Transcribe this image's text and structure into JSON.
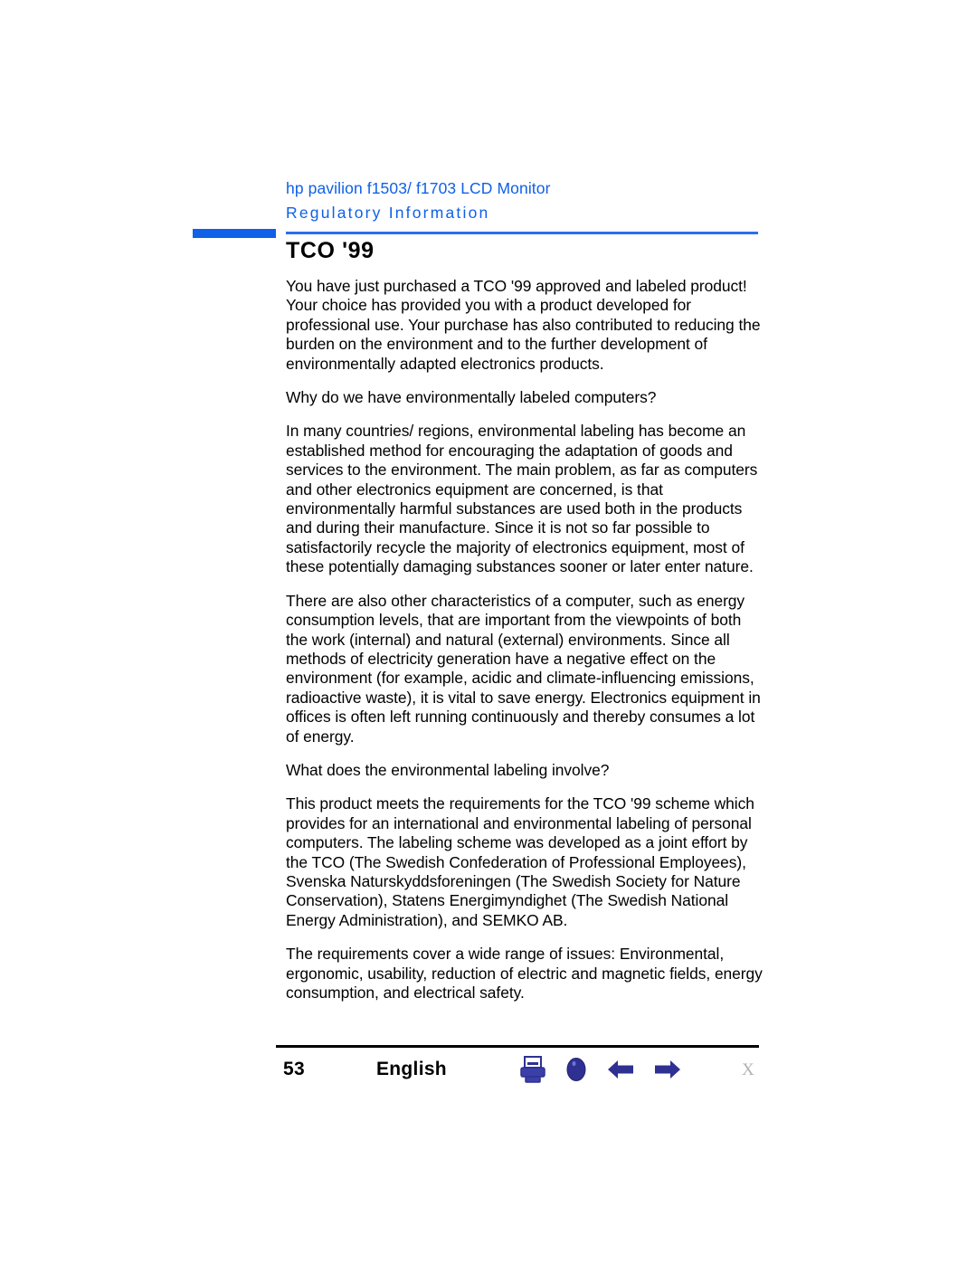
{
  "document": {
    "header": {
      "product_title": "hp pavilion f1503/ f1703 LCD Monitor",
      "section_title": "Regulatory Information",
      "accent_color": "#1060e8",
      "rule_color": "#2a6ff0"
    },
    "heading": "TCO '99",
    "paragraphs": [
      "You have just purchased a TCO '99 approved and labeled product! Your choice has provided you with a product developed for professional use. Your purchase has also contributed to reducing the burden on the environment and to the further development of environmentally adapted electronics products.",
      "Why do we have environmentally labeled computers?",
      "In many countries/ regions, environmental labeling has become an established method for encouraging the adaptation of goods and services to the environment. The main problem, as far as computers and other electronics equipment are concerned, is that environmentally harmful substances are used both in the products and during their manufacture. Since it is not so far possible to satisfactorily recycle the majority of electronics equipment, most of these potentially damaging substances sooner or later enter nature.",
      "There are also other characteristics of a computer, such as energy consumption levels, that are important from the viewpoints of both the work (internal) and natural (external) environments. Since all methods of electricity generation have a negative effect on the environment (for example, acidic and climate-influencing emissions, radioactive waste), it is vital to save energy. Electronics equipment in offices is often left running continuously and thereby consumes a lot of energy.",
      "What does the environmental labeling involve?",
      "This product meets the requirements for the TCO '99 scheme which provides for an international and environmental labeling of personal computers. The labeling scheme was developed as a joint effort by the TCO (The Swedish Confederation of Professional Employees), Svenska Naturskyddsforeningen (The Swedish Society for Nature Conservation), Statens Energimyndighet (The Swedish National Energy Administration), and SEMKO AB.",
      "The requirements cover a wide range of issues: Environmental, ergonomic, usability, reduction of electric and magnetic fields, energy consumption, and electrical safety."
    ],
    "footer": {
      "page_number": "53",
      "language": "English",
      "close_marker": "X",
      "icon_color": "#2e3192",
      "icons": [
        {
          "name": "print-icon",
          "label": "Print"
        },
        {
          "name": "back-to-top-icon",
          "label": "Top"
        },
        {
          "name": "previous-page-icon",
          "label": "Previous"
        },
        {
          "name": "next-page-icon",
          "label": "Next"
        }
      ]
    }
  }
}
